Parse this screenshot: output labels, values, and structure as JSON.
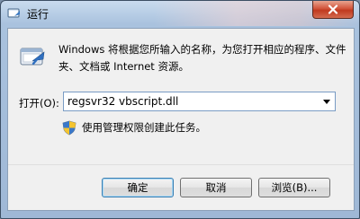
{
  "window": {
    "title": "运行"
  },
  "dialog": {
    "description": "Windows 将根据您所输入的名称，为您打开相应的程序、文件夹、文档或 Internet 资源。",
    "open_label": "打开(O):",
    "command_value": "regsvr32 vbscript.dll",
    "admin_note": "使用管理权限创建此任务。"
  },
  "buttons": {
    "ok": "确定",
    "cancel": "取消",
    "browse": "浏览(B)..."
  },
  "colors": {
    "title_bar": "#a9c2de",
    "close_button": "#c0391f",
    "client_bg": "#f0f0f0"
  },
  "icons": {
    "title": "run-dialog-icon",
    "close": "close-icon",
    "run": "run-program-icon",
    "dropdown": "chevron-down-icon",
    "admin": "uac-shield-icon"
  }
}
